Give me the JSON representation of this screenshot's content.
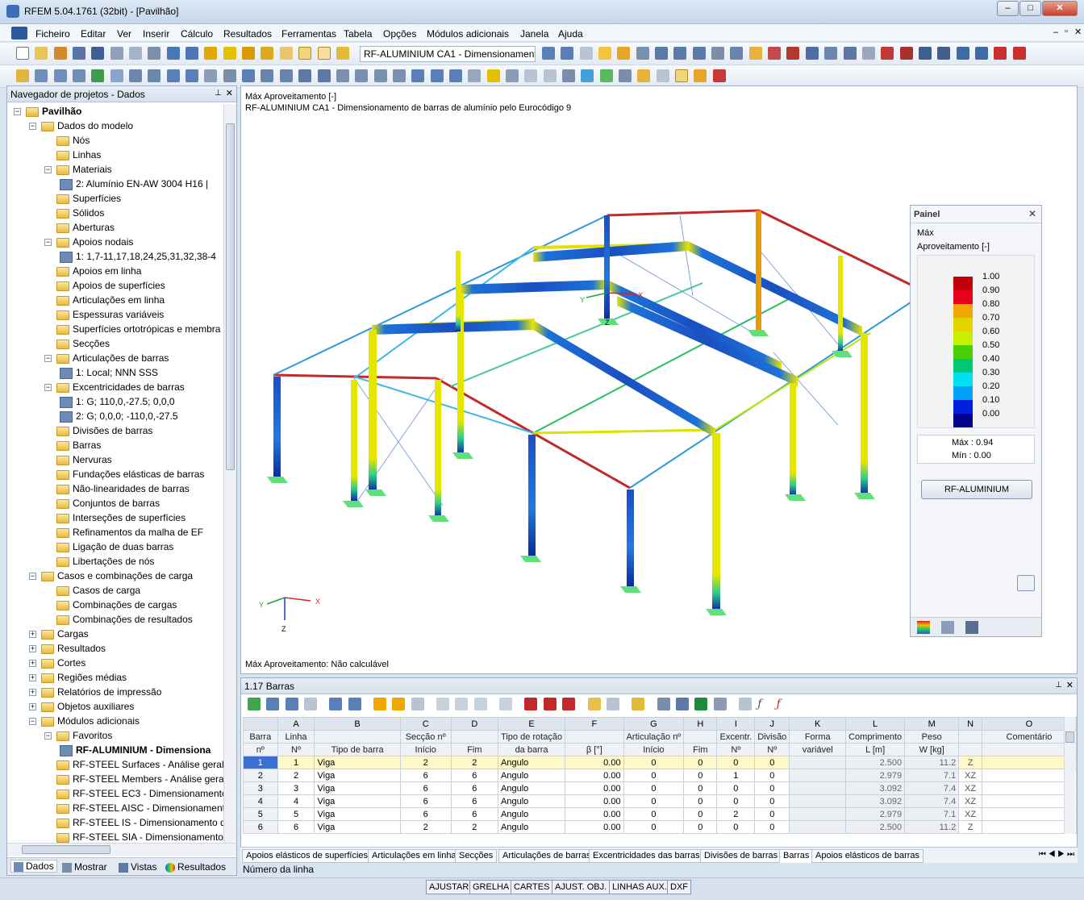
{
  "window": {
    "title": "RFEM 5.04.1761 (32bit) - [Pavilhão]",
    "min": "–",
    "max": "□",
    "close": "✕"
  },
  "menu": [
    "Ficheiro",
    "Editar",
    "Ver",
    "Inserir",
    "Cálculo",
    "Resultados",
    "Ferramentas",
    "Tabela",
    "Opções",
    "Módulos adicionais",
    "Janela",
    "Ajuda"
  ],
  "toolbar": {
    "module_select": "RF-ALUMINIUM CA1 - Dimensionament"
  },
  "navigator": {
    "title": "Navegador de projetos - Dados",
    "tree": [
      {
        "label": "Pavilhão",
        "level": 0,
        "bold": true
      },
      {
        "label": "Dados do modelo",
        "level": 1
      },
      {
        "label": "Nós",
        "level": 2
      },
      {
        "label": "Linhas",
        "level": 2
      },
      {
        "label": "Materiais",
        "level": 2
      },
      {
        "label": "2: Alumínio EN-AW 3004 H16 |",
        "level": 3
      },
      {
        "label": "Superfícies",
        "level": 2
      },
      {
        "label": "Sólidos",
        "level": 2
      },
      {
        "label": "Aberturas",
        "level": 2
      },
      {
        "label": "Apoios nodais",
        "level": 2
      },
      {
        "label": "1: 1,7-11,17,18,24,25,31,32,38-4",
        "level": 3
      },
      {
        "label": "Apoios em linha",
        "level": 2
      },
      {
        "label": "Apoios de superfícies",
        "level": 2
      },
      {
        "label": "Articulações em linha",
        "level": 2
      },
      {
        "label": "Espessuras variáveis",
        "level": 2
      },
      {
        "label": "Superfícies ortotrópicas e membra",
        "level": 2
      },
      {
        "label": "Secções",
        "level": 2
      },
      {
        "label": "Articulações de barras",
        "level": 2
      },
      {
        "label": "1: Local; NNN SSS",
        "level": 3
      },
      {
        "label": "Excentricidades de barras",
        "level": 2
      },
      {
        "label": "1: G; 110,0,-27.5; 0,0,0",
        "level": 3
      },
      {
        "label": "2: G; 0,0,0; -110,0,-27.5",
        "level": 3
      },
      {
        "label": "Divisões de barras",
        "level": 2
      },
      {
        "label": "Barras",
        "level": 2
      },
      {
        "label": "Nervuras",
        "level": 2
      },
      {
        "label": "Fundações elásticas de barras",
        "level": 2
      },
      {
        "label": "Não-linearidades de barras",
        "level": 2
      },
      {
        "label": "Conjuntos de barras",
        "level": 2
      },
      {
        "label": "Interseções de superfícies",
        "level": 2
      },
      {
        "label": "Refinamentos da malha de EF",
        "level": 2
      },
      {
        "label": "Ligação de duas barras",
        "level": 2
      },
      {
        "label": "Libertações de nós",
        "level": 2
      },
      {
        "label": "Casos e combinações de carga",
        "level": 1
      },
      {
        "label": "Casos de carga",
        "level": 2
      },
      {
        "label": "Combinações de cargas",
        "level": 2
      },
      {
        "label": "Combinações de resultados",
        "level": 2
      },
      {
        "label": "Cargas",
        "level": 1
      },
      {
        "label": "Resultados",
        "level": 1
      },
      {
        "label": "Cortes",
        "level": 1
      },
      {
        "label": "Regiões médias",
        "level": 1
      },
      {
        "label": "Relatórios de impressão",
        "level": 1
      },
      {
        "label": "Objetos auxiliares",
        "level": 1
      },
      {
        "label": "Módulos adicionais",
        "level": 1
      },
      {
        "label": "Favoritos",
        "level": 2
      },
      {
        "label": "RF-ALUMINIUM - Dimensiona",
        "level": 3,
        "bold": true
      },
      {
        "label": "RF-STEEL Surfaces - Análise geral d",
        "level": 2
      },
      {
        "label": "RF-STEEL Members - Análise geral",
        "level": 2
      },
      {
        "label": "RF-STEEL EC3 - Dimensionamento",
        "level": 2
      },
      {
        "label": "RF-STEEL AISC - Dimensionament",
        "level": 2
      },
      {
        "label": "RF-STEEL IS - Dimensionamento d",
        "level": 2
      },
      {
        "label": "RF-STEEL SIA - Dimensionamento",
        "level": 2
      }
    ],
    "tabs": [
      "Dados",
      "Mostrar",
      "Vistas",
      "Resultados"
    ]
  },
  "viewport": {
    "line1": "Máx Aproveitamento [-]",
    "line2": "RF-ALUMINIUM CA1 - Dimensionamento de barras de alumínio pelo Eurocódigo 9",
    "bottom": "Máx Aproveitamento: Não calculável",
    "axis": {
      "x": "X",
      "y": "Y",
      "z": "Z"
    }
  },
  "painel": {
    "title": "Painel",
    "max_label": "Máx",
    "quantity": "Aproveitamento [-]",
    "scale": [
      {
        "v": "1.00",
        "c": "#c0000b"
      },
      {
        "v": "0.90",
        "c": "#e8001c"
      },
      {
        "v": "0.80",
        "c": "#f0a800"
      },
      {
        "v": "0.70",
        "c": "#e3d400"
      },
      {
        "v": "0.60",
        "c": "#c6f000"
      },
      {
        "v": "0.50",
        "c": "#48d000"
      },
      {
        "v": "0.40",
        "c": "#00c870"
      },
      {
        "v": "0.30",
        "c": "#00e0f0"
      },
      {
        "v": "0.20",
        "c": "#009ff8"
      },
      {
        "v": "0.10",
        "c": "#0020e0"
      },
      {
        "v": "0.00",
        "c": "#00008c"
      }
    ],
    "max_text": "Máx  :  0.94",
    "min_text": "Mín   :  0.00",
    "button": "RF-ALUMINIUM"
  },
  "table": {
    "title": "1.17 Barras",
    "col_letters": [
      "A",
      "B",
      "C",
      "D",
      "E",
      "F",
      "G",
      "H",
      "I",
      "J",
      "K",
      "L",
      "M",
      "N",
      "O"
    ],
    "hdr1": [
      "Barra",
      "Linha",
      "",
      "Secção nº",
      "",
      "Tipo de rotação",
      "",
      "Articulação nº",
      "",
      "Excentr.",
      "Divisão",
      "Forma",
      "Comprimento",
      "Peso",
      "",
      "Comentário"
    ],
    "hdr2": [
      "nº",
      "Nº",
      "Tipo de barra",
      "Início",
      "Fim",
      "da barra",
      "β [°]",
      "Início",
      "Fim",
      "Nº",
      "Nº",
      "variável",
      "L [m]",
      "W [kg]",
      "",
      ""
    ],
    "rows": [
      [
        "1",
        "1",
        "Viga",
        "2",
        "2",
        "Angulo",
        "0.00",
        "0",
        "0",
        "0",
        "0",
        "",
        "2.500",
        "11.2",
        "Z",
        ""
      ],
      [
        "2",
        "2",
        "Viga",
        "6",
        "6",
        "Angulo",
        "0.00",
        "0",
        "0",
        "1",
        "0",
        "",
        "2.979",
        "7.1",
        "XZ",
        ""
      ],
      [
        "3",
        "3",
        "Viga",
        "6",
        "6",
        "Angulo",
        "0.00",
        "0",
        "0",
        "0",
        "0",
        "",
        "3.092",
        "7.4",
        "XZ",
        ""
      ],
      [
        "4",
        "4",
        "Viga",
        "6",
        "6",
        "Angulo",
        "0.00",
        "0",
        "0",
        "0",
        "0",
        "",
        "3.092",
        "7.4",
        "XZ",
        ""
      ],
      [
        "5",
        "5",
        "Viga",
        "6",
        "6",
        "Angulo",
        "0.00",
        "0",
        "0",
        "2",
        "0",
        "",
        "2.979",
        "7.1",
        "XZ",
        ""
      ],
      [
        "6",
        "6",
        "Viga",
        "2",
        "2",
        "Angulo",
        "0.00",
        "0",
        "0",
        "0",
        "0",
        "",
        "2.500",
        "11.2",
        "Z",
        ""
      ]
    ],
    "tabs": [
      "Apoios elásticos de superfícies",
      "Articulações em linha",
      "Secções",
      "Articulações de barras",
      "Excentricidades das barras",
      "Divisões de barras",
      "Barras",
      "Apoios elásticos de barras"
    ],
    "active_tab": "Barras",
    "status": "Número da linha"
  },
  "statusbar": [
    "AJUSTAR",
    "GRELHA",
    "CARTES",
    "AJUST. OBJ.",
    "LINHAS AUX.",
    "DXF"
  ]
}
